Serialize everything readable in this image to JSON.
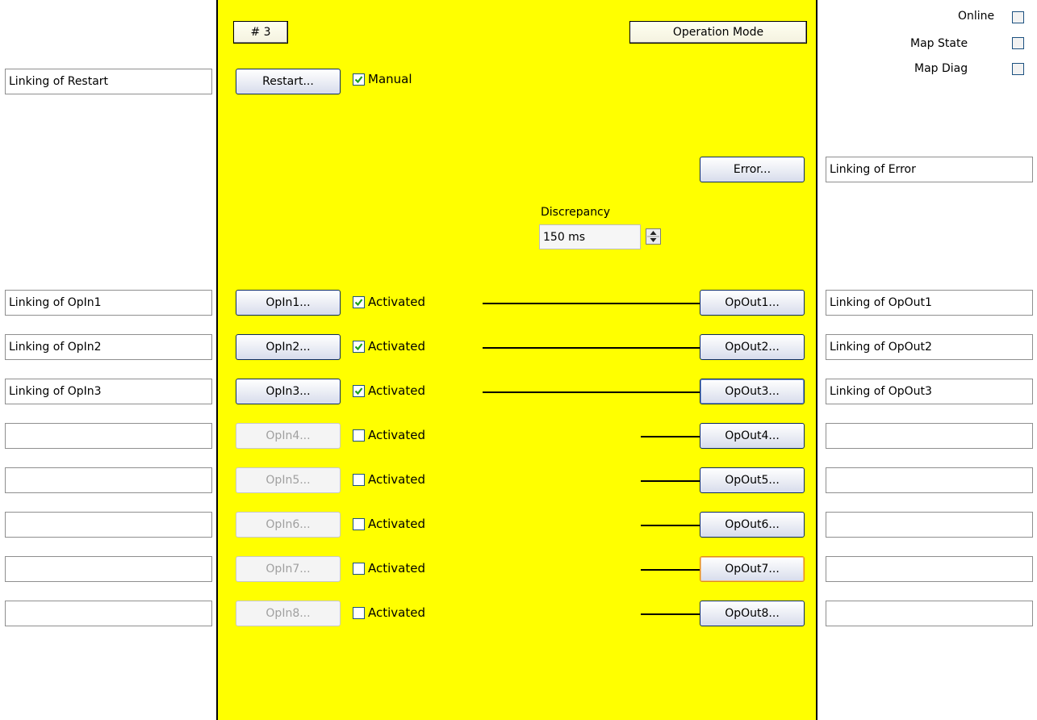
{
  "status": {
    "online_label": "Online",
    "map_state_label": "Map State",
    "map_diag_label": "Map Diag"
  },
  "panel": {
    "number_label": "# 3",
    "operation_mode_label": "Operation Mode",
    "restart_label": "Restart...",
    "manual_label": "Manual",
    "manual_checked": true,
    "error_label": "Error...",
    "discrepancy_label": "Discrepancy",
    "discrepancy_value": "150 ms",
    "background_color": "#ffff00"
  },
  "links": {
    "restart": "Linking of Restart",
    "error": "Linking of Error"
  },
  "rows": [
    {
      "in_label": "OpIn1...",
      "in_enabled": true,
      "activated_label": "Activated",
      "activated": true,
      "out_label": "OpOut1...",
      "in_link": "Linking of OpIn1",
      "out_link": "Linking of OpOut1"
    },
    {
      "in_label": "OpIn2...",
      "in_enabled": true,
      "activated_label": "Activated",
      "activated": true,
      "out_label": "OpOut2...",
      "in_link": "Linking of OpIn2",
      "out_link": "Linking of OpOut2"
    },
    {
      "in_label": "OpIn3...",
      "in_enabled": true,
      "activated_label": "Activated",
      "activated": true,
      "out_label": "OpOut3...",
      "in_link": "Linking of OpIn3",
      "out_link": "Linking of OpOut3"
    },
    {
      "in_label": "OpIn4...",
      "in_enabled": false,
      "activated_label": "Activated",
      "activated": false,
      "out_label": "OpOut4...",
      "in_link": "",
      "out_link": ""
    },
    {
      "in_label": "OpIn5...",
      "in_enabled": false,
      "activated_label": "Activated",
      "activated": false,
      "out_label": "OpOut5...",
      "in_link": "",
      "out_link": ""
    },
    {
      "in_label": "OpIn6...",
      "in_enabled": false,
      "activated_label": "Activated",
      "activated": false,
      "out_label": "OpOut6...",
      "in_link": "",
      "out_link": ""
    },
    {
      "in_label": "OpIn7...",
      "in_enabled": false,
      "activated_label": "Activated",
      "activated": false,
      "out_label": "OpOut7...",
      "in_link": "",
      "out_link": ""
    },
    {
      "in_label": "OpIn8...",
      "in_enabled": false,
      "activated_label": "Activated",
      "activated": false,
      "out_label": "OpOut8...",
      "in_link": "",
      "out_link": ""
    }
  ]
}
